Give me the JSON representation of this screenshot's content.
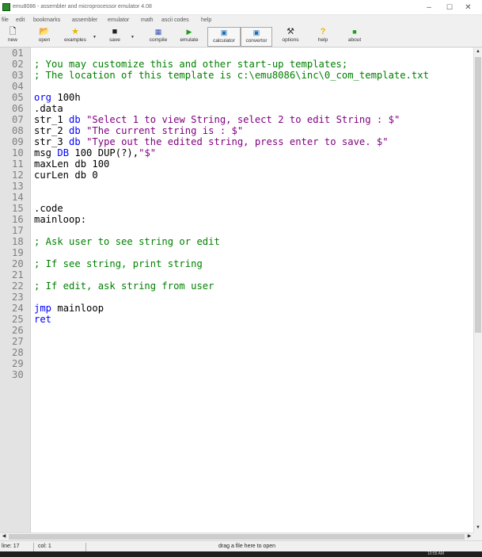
{
  "window": {
    "title": "emu8086 - assembler and microprocessor emulator 4.08",
    "minimize_glyph": "–",
    "maximize_glyph": "☐",
    "close_glyph": "✕"
  },
  "menu": [
    "file",
    "edit",
    "bookmarks",
    "assembler",
    "emulator",
    "math",
    "ascii codes",
    "help"
  ],
  "toolbar": {
    "new": "new",
    "open": "open",
    "examples": "examples",
    "save": "save",
    "compile": "compile",
    "emulate": "emulate",
    "calculator": "calculator",
    "convertor": "convertor",
    "options": "options",
    "help": "help",
    "about": "about",
    "icons": {
      "new": "new-document-icon",
      "open": "open-folder-icon",
      "examples": "star-icon",
      "save": "floppy-disk-icon",
      "compile": "compile-icon",
      "emulate": "play-icon",
      "calculator": "calculator-icon",
      "convertor": "convertor-icon",
      "options": "tools-icon",
      "help": "help-icon",
      "about": "chip-icon"
    }
  },
  "editor": {
    "line_numbers": [
      "01",
      "02",
      "03",
      "04",
      "05",
      "06",
      "07",
      "08",
      "09",
      "10",
      "11",
      "12",
      "13",
      "14",
      "15",
      "16",
      "17",
      "18",
      "19",
      "20",
      "21",
      "22",
      "23",
      "24",
      "25",
      "26",
      "27",
      "28",
      "29",
      "30"
    ],
    "lines": [
      [],
      [
        {
          "c": "com",
          "t": "; You may customize this and other start-up templates;"
        }
      ],
      [
        {
          "c": "com",
          "t": "; The location of this template is c:\\emu8086\\inc\\0_com_template.txt"
        }
      ],
      [],
      [
        {
          "c": "kw",
          "t": "org"
        },
        {
          "c": "txt",
          "t": " 100h"
        }
      ],
      [
        {
          "c": "txt",
          "t": ".data"
        }
      ],
      [
        {
          "c": "txt",
          "t": "str_1 "
        },
        {
          "c": "kw",
          "t": "db"
        },
        {
          "c": "txt",
          "t": " "
        },
        {
          "c": "str",
          "t": "\"Select 1 to view String, select 2 to edit String : $\""
        }
      ],
      [
        {
          "c": "txt",
          "t": "str_2 "
        },
        {
          "c": "kw",
          "t": "db"
        },
        {
          "c": "txt",
          "t": " "
        },
        {
          "c": "str",
          "t": "\"The current string is : $\""
        }
      ],
      [
        {
          "c": "txt",
          "t": "str_3 "
        },
        {
          "c": "kw",
          "t": "db"
        },
        {
          "c": "txt",
          "t": " "
        },
        {
          "c": "str",
          "t": "\"Type out the edited string, press enter to save. $\""
        }
      ],
      [
        {
          "c": "txt",
          "t": "msg "
        },
        {
          "c": "kw",
          "t": "DB"
        },
        {
          "c": "txt",
          "t": " 100 DUP(?),"
        },
        {
          "c": "str",
          "t": "\"$\""
        }
      ],
      [
        {
          "c": "txt",
          "t": "maxLen db 100"
        }
      ],
      [
        {
          "c": "txt",
          "t": "curLen db 0"
        }
      ],
      [],
      [],
      [
        {
          "c": "txt",
          "t": ".code"
        }
      ],
      [
        {
          "c": "txt",
          "t": "mainloop:"
        }
      ],
      [],
      [
        {
          "c": "com",
          "t": "; Ask user to see string or edit"
        }
      ],
      [],
      [
        {
          "c": "com",
          "t": "; If see string, print string"
        }
      ],
      [],
      [
        {
          "c": "com",
          "t": "; If edit, ask string from user"
        }
      ],
      [],
      [
        {
          "c": "kw",
          "t": "jmp"
        },
        {
          "c": "txt",
          "t": " mainloop"
        }
      ],
      [
        {
          "c": "kw",
          "t": "ret"
        }
      ],
      [],
      [],
      [],
      [],
      []
    ],
    "colors": {
      "comment": "#008000",
      "string": "#800080",
      "keyword": "#0000ff",
      "text": "#000000",
      "line_number": "#7f7f7f"
    }
  },
  "statusbar": {
    "line": "line: 17",
    "col": "col: 1",
    "hint": "drag a file here to open"
  },
  "taskbar": {
    "clock": "10:55 AM"
  }
}
